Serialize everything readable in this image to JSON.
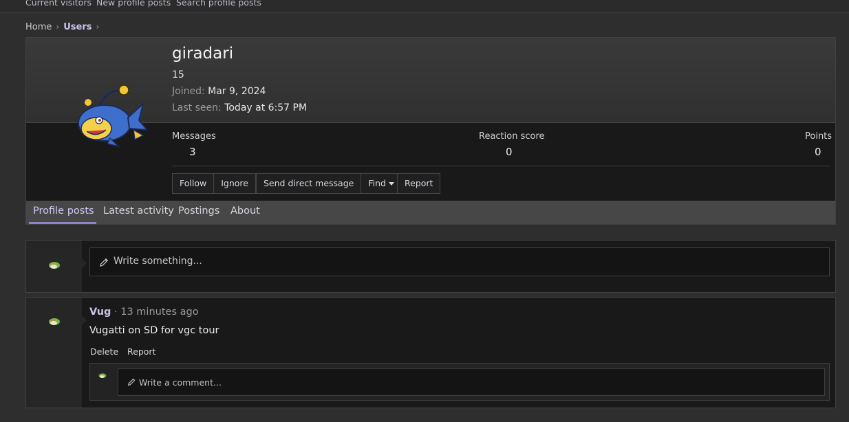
{
  "subnav": {
    "items": [
      "Current visitors",
      "New profile posts",
      "Search profile posts"
    ]
  },
  "breadcrumb": {
    "home": "Home",
    "users": "Users",
    "separator": "›"
  },
  "profile": {
    "username": "giradari",
    "title": "15",
    "joined_label": "Joined:",
    "joined_value": "Mar 9, 2024",
    "last_seen_label": "Last seen:",
    "last_seen_value": "Today at 6:57 PM",
    "stats": {
      "messages_label": "Messages",
      "messages_value": "3",
      "reaction_label": "Reaction score",
      "reaction_value": "0",
      "points_label": "Points",
      "points_value": "0"
    },
    "buttons": {
      "follow": "Follow",
      "ignore": "Ignore",
      "send_dm": "Send direct message",
      "find": "Find",
      "report": "Report"
    },
    "tabs": [
      "Profile posts",
      "Latest activity",
      "Postings",
      "About"
    ],
    "active_tab": "Profile posts"
  },
  "composer": {
    "placeholder": "Write something..."
  },
  "post": {
    "author": "Vug",
    "time": "· 13 minutes ago",
    "body": "Vugatti on SD for vgc tour",
    "actions": {
      "delete": "Delete",
      "report": "Report"
    },
    "comment_placeholder": "Write a comment..."
  },
  "icons": {
    "pencil": "pencil-icon",
    "caret": "chevron-down-icon"
  },
  "colors": {
    "accent": "#8f86c9",
    "link": "#c9c4e8",
    "background": "#2e2e2e"
  }
}
